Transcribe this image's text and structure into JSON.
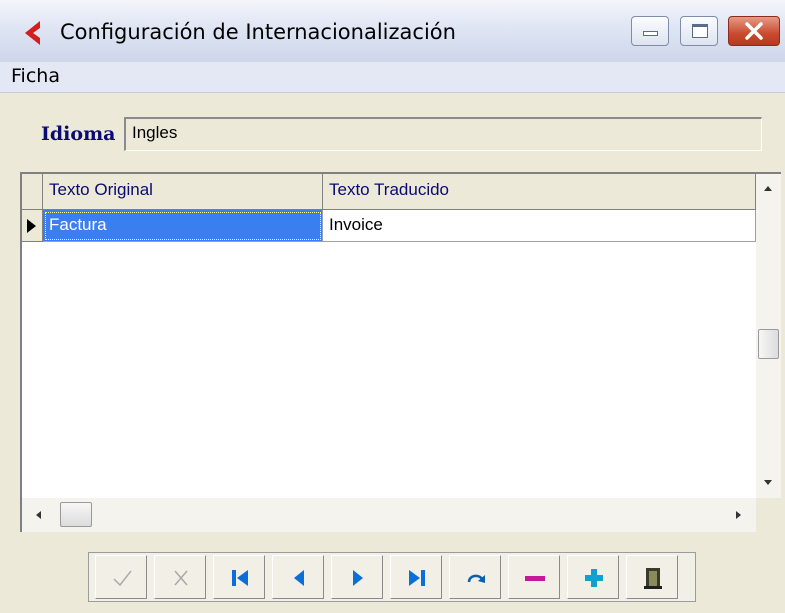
{
  "window": {
    "title": "Configuración de Internacionalización",
    "icon": "app-red-arrow-icon",
    "caption_buttons": [
      "minimize-icon",
      "maximize-icon",
      "close-icon"
    ]
  },
  "menu": {
    "items": [
      {
        "label": "Ficha"
      }
    ]
  },
  "language": {
    "label": "Idioma",
    "value": "Ingles"
  },
  "grid": {
    "columns": [
      "Texto Original",
      "Texto Traducido"
    ],
    "rows": [
      {
        "original": "Factura",
        "translated": "Invoice",
        "selected": true
      }
    ]
  },
  "navigator": {
    "buttons": [
      {
        "name": "post-button",
        "icon": "check-icon",
        "enabled": false
      },
      {
        "name": "cancel-button",
        "icon": "x-icon",
        "enabled": false
      },
      {
        "name": "first-record-button",
        "icon": "first-icon",
        "enabled": true
      },
      {
        "name": "prior-record-button",
        "icon": "prior-icon",
        "enabled": true
      },
      {
        "name": "next-record-button",
        "icon": "next-icon",
        "enabled": true
      },
      {
        "name": "last-record-button",
        "icon": "last-icon",
        "enabled": true
      },
      {
        "name": "refresh-button",
        "icon": "refresh-icon",
        "enabled": true
      },
      {
        "name": "delete-button",
        "icon": "minus-icon",
        "enabled": true
      },
      {
        "name": "insert-button",
        "icon": "plus-icon",
        "enabled": true
      },
      {
        "name": "exit-button",
        "icon": "door-icon",
        "enabled": true
      }
    ]
  },
  "colors": {
    "selection": "#3a7ff0",
    "header_text": "#0a0a72",
    "nav_blue": "#0a6fd6",
    "minus_magenta": "#c8189a",
    "plus_cyan": "#159fd1"
  }
}
